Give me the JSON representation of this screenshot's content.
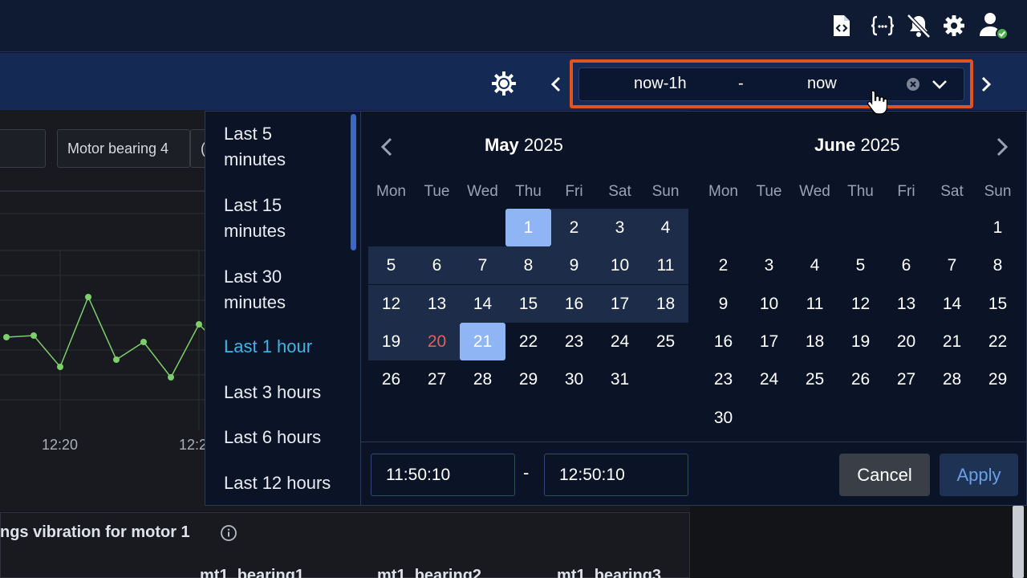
{
  "range": {
    "from": "now-1h",
    "separator": "-",
    "to": "now"
  },
  "dashboard": {
    "chip_label": "Motor bearing 4",
    "chip_next_partial": "(",
    "x_ticks": [
      "12:20",
      "12:2"
    ],
    "panel2_title": "ngs vibration for motor 1",
    "columns": [
      "mt1_bearing1",
      "mt1_bearing2",
      "mt1_bearing3"
    ]
  },
  "quick_ranges": [
    {
      "label": "Last 5 minutes",
      "line1": "Last 5",
      "line2": "minutes"
    },
    {
      "label": "Last 15 minutes",
      "line1": "Last 15",
      "line2": "minutes"
    },
    {
      "label": "Last 30 minutes",
      "line1": "Last 30",
      "line2": "minutes"
    },
    {
      "label": "Last 1 hour",
      "active": true
    },
    {
      "label": "Last 3 hours"
    },
    {
      "label": "Last 6 hours"
    },
    {
      "label": "Last 12 hours"
    }
  ],
  "calendar": {
    "left": {
      "month": "May",
      "year": "2025"
    },
    "right": {
      "month": "June",
      "year": "2025"
    },
    "weekdays": [
      "Mon",
      "Tue",
      "Wed",
      "Thu",
      "Fri",
      "Sat",
      "Sun"
    ],
    "range_start": "1",
    "range_end": "21",
    "today": "20"
  },
  "time": {
    "start": "11:50:10",
    "separator": "-",
    "end": "12:50:10"
  },
  "buttons": {
    "cancel": "Cancel",
    "apply": "Apply"
  },
  "colors": {
    "accent_frame": "#e2541f",
    "active_quick": "#3fb6e6",
    "selected_day": "#8fb5f4",
    "today": "#e0605a",
    "series": "#7ccf6a"
  },
  "chart_data": {
    "type": "line",
    "series": [
      {
        "values": [
          420,
          418,
          457,
          370,
          448,
          426,
          470,
          404,
          438
        ]
      }
    ]
  }
}
